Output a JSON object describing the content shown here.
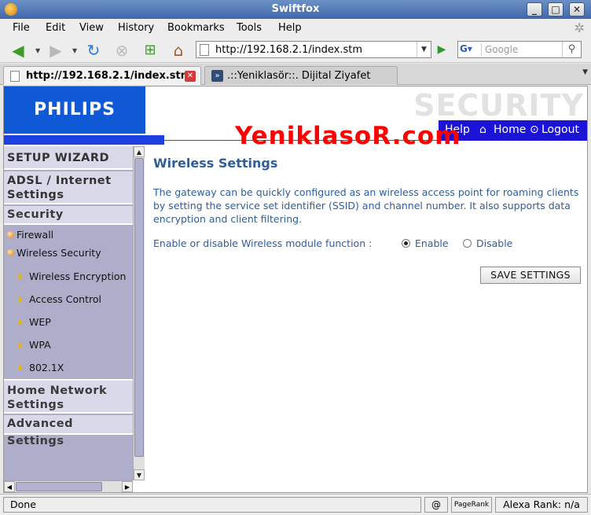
{
  "window": {
    "title": "Swiftfox"
  },
  "menu": [
    "File",
    "Edit",
    "View",
    "History",
    "Bookmarks",
    "Tools",
    "Help"
  ],
  "nav": {
    "url": "http://192.168.2.1/index.stm",
    "search_placeholder": "Google"
  },
  "tabs": [
    {
      "title": "http://192.168.2.1/index.stm",
      "active": true
    },
    {
      "title": ".::Yeniklasör::. Dijital Ziyafet",
      "active": false
    }
  ],
  "header": {
    "brand": "PHILIPS",
    "section_title": "SECURITY",
    "links": {
      "help": "Help",
      "home": "Home",
      "logout": "Logout"
    },
    "watermark": "YeniklasoR.com"
  },
  "sidebar": {
    "setup_wizard": "SETUP WIZARD",
    "adsl": "ADSL / Internet Settings",
    "security": "Security",
    "firewall": "Firewall",
    "wireless_security": "Wireless Security",
    "wireless_items": [
      "Wireless Encryption",
      "Access Control",
      "WEP",
      "WPA",
      "802.1X"
    ],
    "home_network": "Home Network Settings",
    "advanced": "Advanced Settings"
  },
  "main": {
    "heading": "Wireless Settings",
    "description": "The gateway can be quickly configured as an wireless access point for roaming clients by setting the service set identifier (SSID) and channel number. It also supports data encryption and client filtering.",
    "module_label": "Enable or disable Wireless module function :",
    "enable_label": "Enable",
    "disable_label": "Disable",
    "selected": "Enable",
    "save_label": "SAVE SETTINGS"
  },
  "status": {
    "text": "Done",
    "pagerank_label": "PageRank",
    "alexa": "Alexa Rank: n/a"
  },
  "colors": {
    "philips_blue": "#0f58d6",
    "nav_blue": "#1b14d6",
    "heading_blue": "#2f5d9a",
    "sidebar_bg": "#aeaecb",
    "watermark_red": "#ff0000"
  }
}
